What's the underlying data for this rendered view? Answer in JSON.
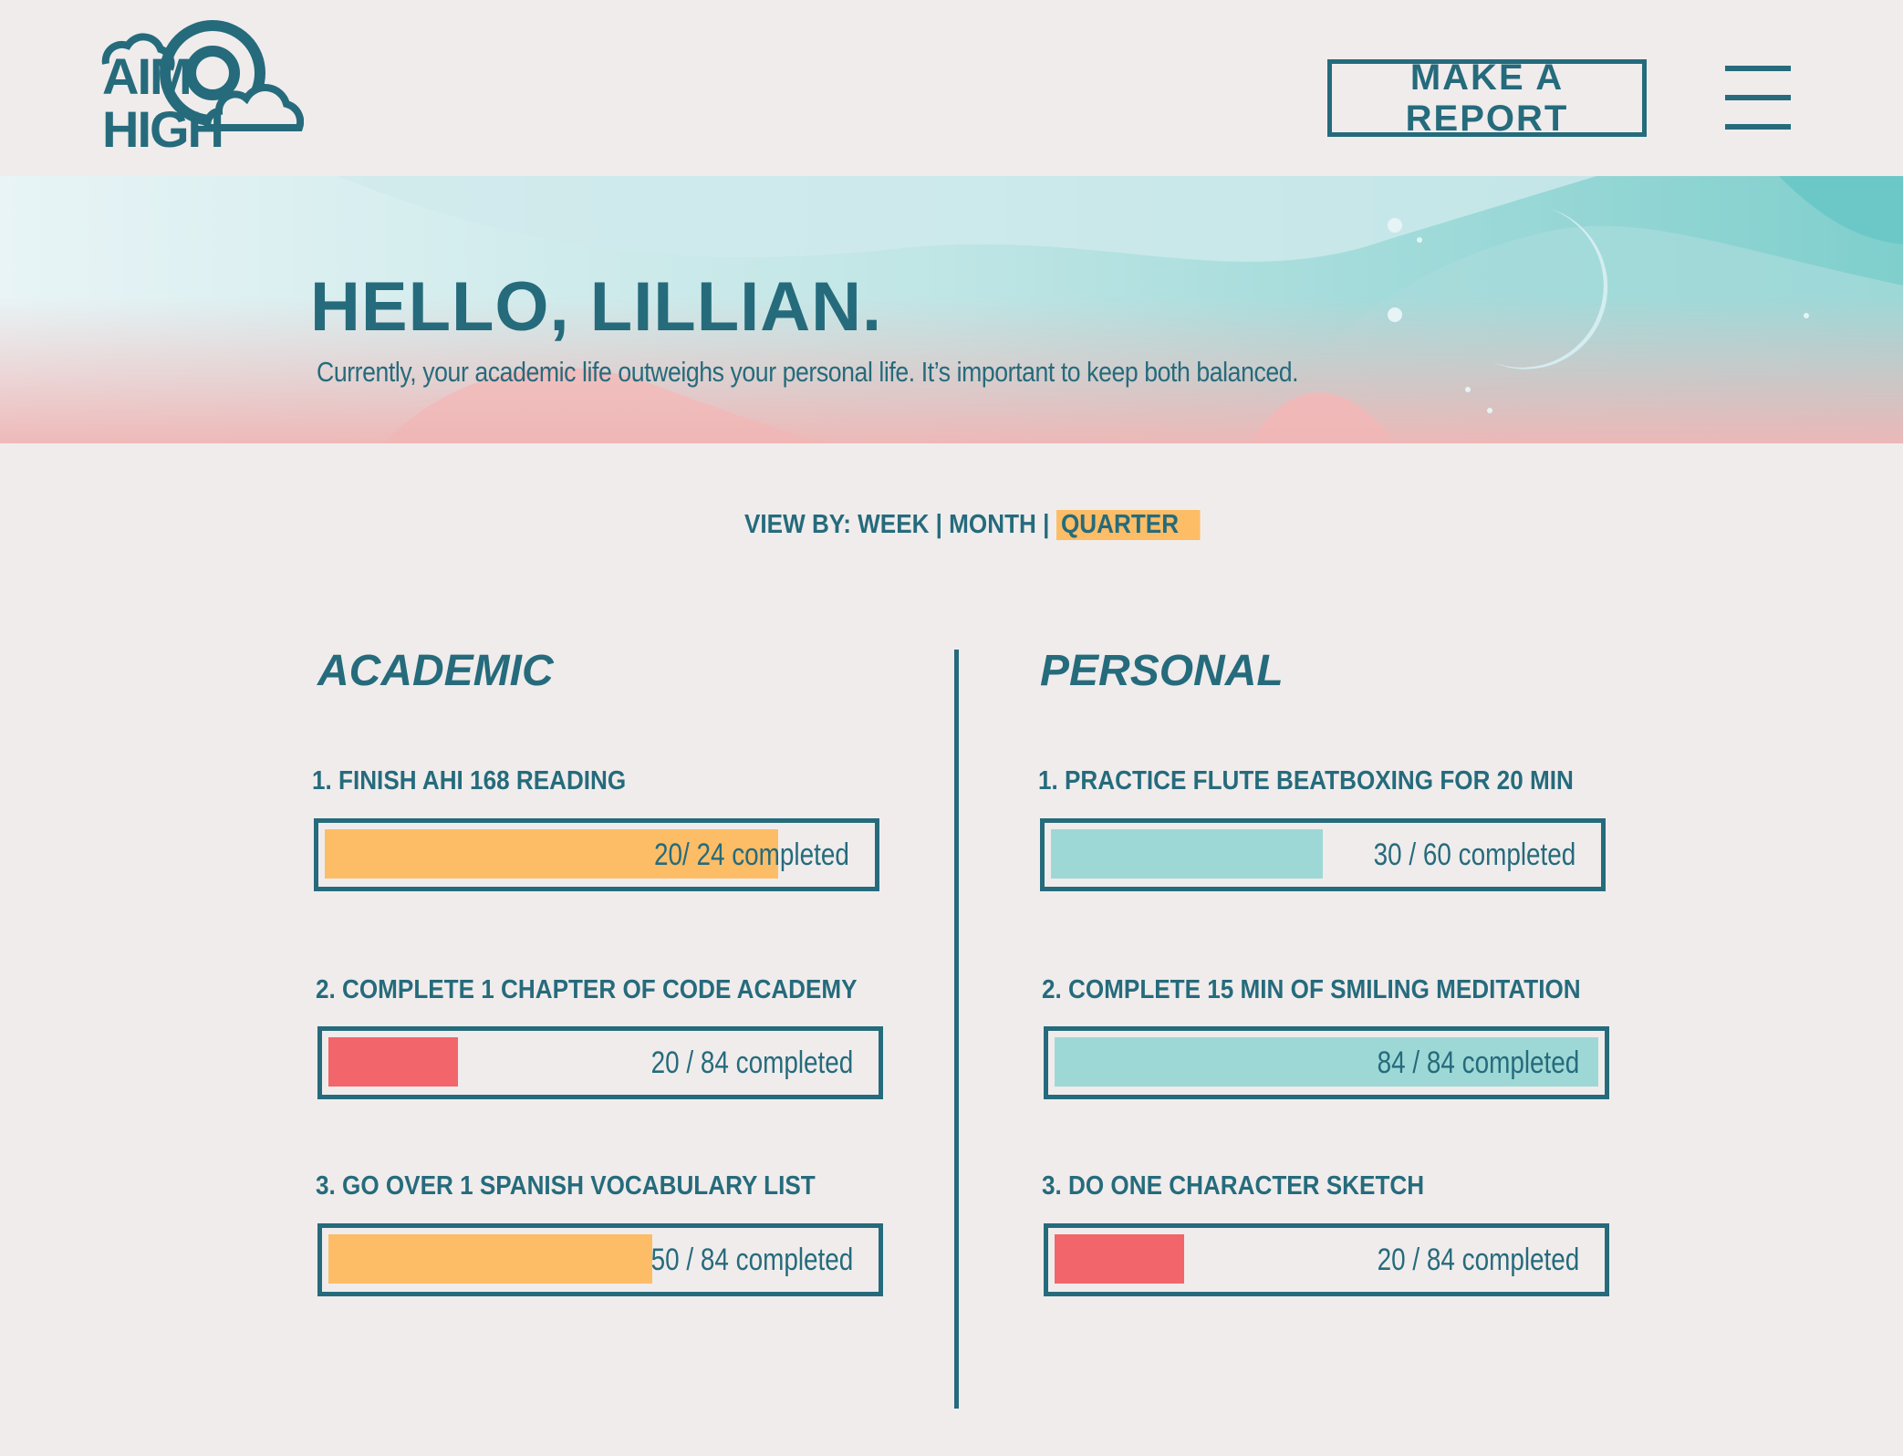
{
  "app": {
    "logo_line1": "AIM",
    "logo_line2": "HIGH",
    "report_button": "MAKE A REPORT",
    "menu_icon": "hamburger-menu-icon"
  },
  "hero": {
    "title": "HELLO, LILLIAN.",
    "subtitle": "Currently, your academic life outweighs your personal life. It’s important to keep both balanced."
  },
  "view_by": {
    "label": "VIEW BY:",
    "options": [
      "WEEK",
      "MONTH",
      "QUARTER"
    ],
    "selected": "QUARTER"
  },
  "colors": {
    "primary": "#256b7c",
    "background": "#f0ecec",
    "orange": "#fdbd66",
    "red": "#f2656a",
    "teal": "#9ed8d6"
  },
  "academic": {
    "title": "ACADEMIC",
    "goals": [
      {
        "label": "1. FINISH AHI 168  READING",
        "progress": "20/ 24 completed",
        "done": 20,
        "total": 24,
        "color": "#fdbd66"
      },
      {
        "label": "2. COMPLETE 1 CHAPTER OF CODE ACADEMY",
        "progress": "20 / 84  completed",
        "done": 20,
        "total": 84,
        "color": "#f2656a"
      },
      {
        "label": "3. GO OVER 1 SPANISH VOCABULARY LIST",
        "progress": "50 / 84  completed",
        "done": 50,
        "total": 84,
        "color": "#fdbd66"
      }
    ]
  },
  "personal": {
    "title": "PERSONAL",
    "goals": [
      {
        "label": "1. PRACTICE FLUTE BEATBOXING FOR 20 MIN",
        "progress": "30 / 60 completed",
        "done": 30,
        "total": 60,
        "color": "#9ed8d6"
      },
      {
        "label": "2. COMPLETE 15 MIN OF SMILING MEDITATION",
        "progress": "84 / 84  completed",
        "done": 84,
        "total": 84,
        "color": "#9ed8d6"
      },
      {
        "label": "3. DO ONE CHARACTER SKETCH",
        "progress": "20 / 84  completed",
        "done": 20,
        "total": 84,
        "color": "#f2656a"
      }
    ]
  }
}
